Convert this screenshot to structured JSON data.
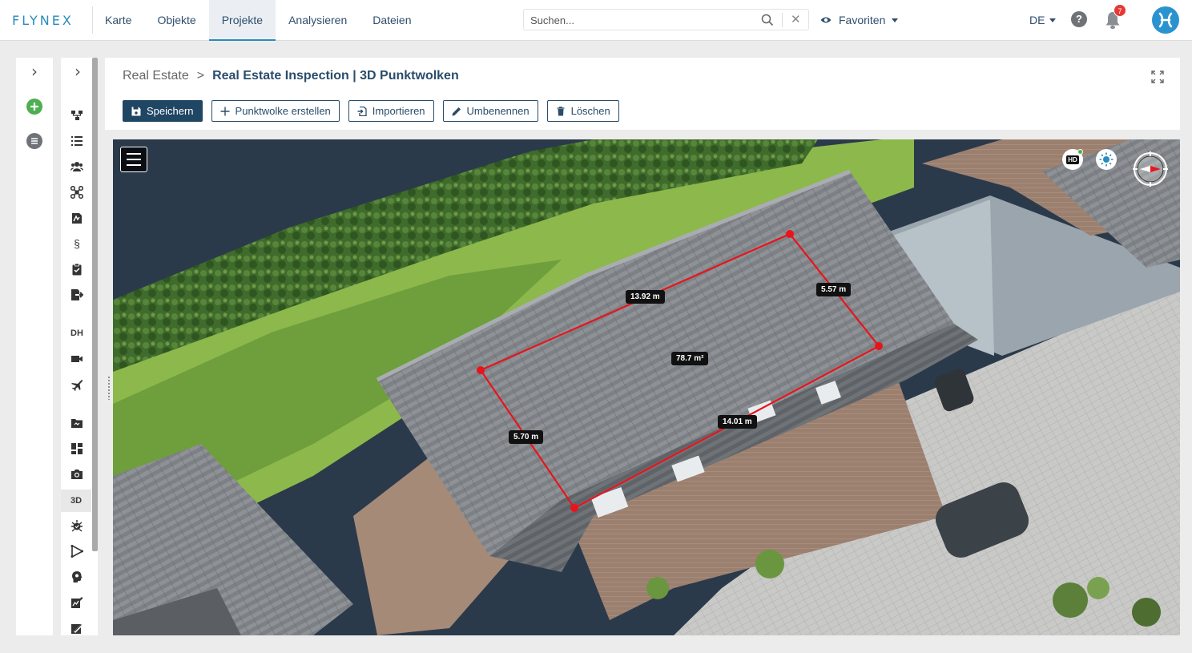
{
  "brand": {
    "logo": "FLYNEX",
    "accent": "#2a8bbd"
  },
  "nav": {
    "items": [
      {
        "label": "Karte",
        "active": false
      },
      {
        "label": "Objekte",
        "active": false
      },
      {
        "label": "Projekte",
        "active": true
      },
      {
        "label": "Analysieren",
        "active": false
      },
      {
        "label": "Dateien",
        "active": false
      }
    ]
  },
  "search": {
    "placeholder": "Suchen...",
    "value": ""
  },
  "favorites": {
    "label": "Favoriten"
  },
  "language": {
    "value": "DE"
  },
  "help": {
    "label": "?"
  },
  "notifications": {
    "count": "7"
  },
  "rail1": {
    "items": [
      "chevron-right",
      "add",
      "list"
    ]
  },
  "rail2": {
    "items": [
      "chevron-right",
      "hierarchy",
      "list",
      "users",
      "drone",
      "document",
      "paragraph",
      "clipboard",
      "export",
      "DH",
      "video",
      "plane",
      "folder",
      "dashboard",
      "camera",
      "3D",
      "bug",
      "vector",
      "head",
      "chart-edit",
      "measure"
    ],
    "label_dh": "DH",
    "label_3d": "3D",
    "active": "3D"
  },
  "breadcrumb": {
    "parent": "Real Estate",
    "separator": ">",
    "current": "Real Estate Inspection | 3D Punktwolken"
  },
  "toolbar": {
    "save_label": "Speichern",
    "create_label": "Punktwolke erstellen",
    "import_label": "Importieren",
    "rename_label": "Umbenennen",
    "delete_label": "Löschen"
  },
  "viewer": {
    "measurements": {
      "top": "13.92 m",
      "right": "5.57 m",
      "bottom": "14.01 m",
      "left": "5.70 m",
      "area": "78.7 m²"
    },
    "hd_label": "HD",
    "measure_color": "#e8141c"
  }
}
